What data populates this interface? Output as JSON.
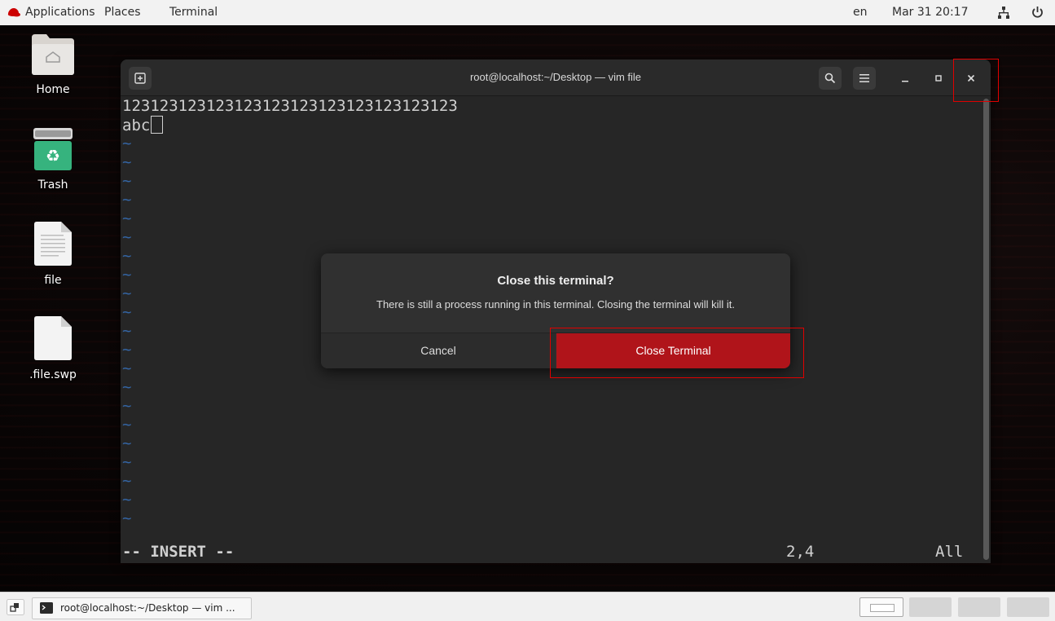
{
  "topbar": {
    "applications": "Applications",
    "places": "Places",
    "terminal": "Terminal",
    "lang": "en",
    "clock": "Mar 31 20:17",
    "network_icon": "network-icon",
    "power_icon": "power-icon"
  },
  "desktop": {
    "icons": [
      {
        "label": "Home",
        "icon": "home-folder-icon"
      },
      {
        "label": "Trash",
        "icon": "trash-icon"
      },
      {
        "label": "file",
        "icon": "text-file-icon"
      },
      {
        "label": ".file.swp",
        "icon": "blank-file-icon"
      }
    ]
  },
  "terminal": {
    "title": "root@localhost:~/Desktop — vim file",
    "lines": [
      "123123123123123123123123123123123123",
      "abc"
    ],
    "tilde": "~",
    "status_mode": "-- INSERT --",
    "status_pos": "2,4",
    "status_scroll": "All"
  },
  "dialog": {
    "title": "Close this terminal?",
    "body": "There is still a process running in this terminal. Closing the terminal will kill it.",
    "cancel": "Cancel",
    "confirm": "Close Terminal"
  },
  "taskbar": {
    "item": "root@localhost:~/Desktop — vim ..."
  },
  "colors": {
    "accent_red": "#b0141a",
    "highlight": "#e00000",
    "tilde_blue": "#3465a4"
  }
}
